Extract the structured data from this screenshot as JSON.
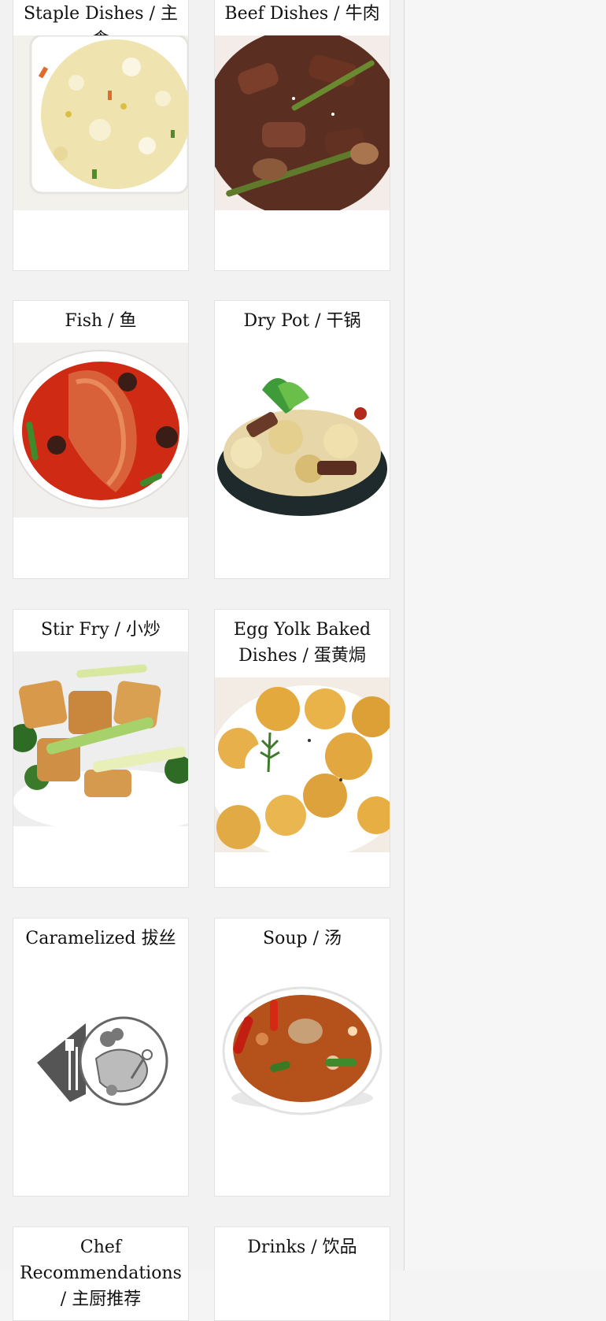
{
  "categories": [
    {
      "title": "Staple Dishes / 主食",
      "image": "fried-rice-image"
    },
    {
      "title": "Beef Dishes / 牛肉",
      "image": "beef-stirfry-image"
    },
    {
      "title": "Fish / 鱼",
      "image": "fish-curry-image"
    },
    {
      "title": "Dry Pot / 干锅",
      "image": "dry-pot-image"
    },
    {
      "title": "Stir Fry / 小炒",
      "image": "tofu-stirfry-image"
    },
    {
      "title": "Egg Yolk Baked Dishes / 蛋黄焗",
      "image": "egg-yolk-baked-image"
    },
    {
      "title": "Caramelized 拔丝",
      "image": "placeholder-plate-icon"
    },
    {
      "title": "Soup / 汤",
      "image": "soup-bowl-image"
    },
    {
      "title": "Chef Recommendations / 主厨推荐",
      "image": ""
    },
    {
      "title": "Drinks / 饮品",
      "image": ""
    }
  ],
  "colors": {
    "card_bg": "#ffffff",
    "page_bg": "#f2f2f2",
    "border": "#e3e3e3"
  }
}
